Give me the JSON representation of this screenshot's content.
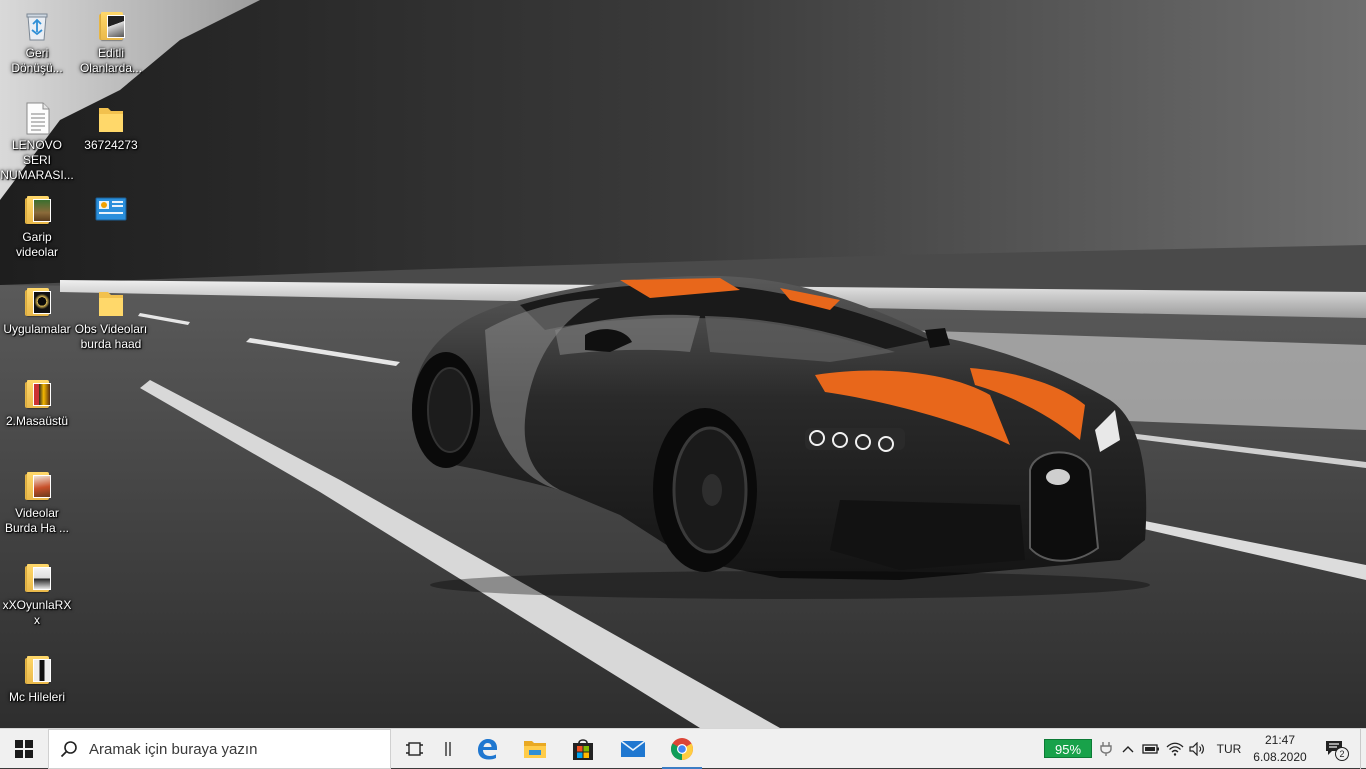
{
  "desktop": {
    "icons": [
      {
        "label": "Geri Dönüşü...",
        "icon": "recycle-bin-icon"
      },
      {
        "label": "Editli Olanlarda...",
        "icon": "folder-icon"
      },
      {
        "label": "LENOVO SERI NUMARASI...",
        "icon": "text-document-icon"
      },
      {
        "label": "36724273",
        "icon": "folder-icon"
      },
      {
        "label": "Garip videolar",
        "icon": "folder-icon"
      },
      {
        "label": "",
        "icon": "control-panel-shortcut-icon"
      },
      {
        "label": "Uygulamalar",
        "icon": "folder-icon"
      },
      {
        "label": "Obs Videoları burda haad",
        "icon": "folder-icon"
      },
      {
        "label": "2.Masaüstü",
        "icon": "folder-icon"
      },
      {
        "label": "Videolar Burda Ha ...",
        "icon": "folder-icon"
      },
      {
        "label": "xXOyunlaRXx",
        "icon": "folder-icon"
      },
      {
        "label": "Mc Hileleri",
        "icon": "folder-icon"
      }
    ]
  },
  "taskbar": {
    "search_placeholder": "Aramak için buraya yazın",
    "apps": [
      {
        "name": "task-view",
        "icon": "task-view-icon"
      },
      {
        "name": "separator",
        "icon": "separator-icon"
      },
      {
        "name": "edge",
        "icon": "edge-icon"
      },
      {
        "name": "file-explorer",
        "icon": "file-explorer-icon"
      },
      {
        "name": "microsoft-store",
        "icon": "store-icon"
      },
      {
        "name": "mail",
        "icon": "mail-icon"
      },
      {
        "name": "chrome",
        "icon": "chrome-icon",
        "active": true
      }
    ],
    "tray": {
      "battery_percent": "95%",
      "language": "TUR",
      "time": "21:47",
      "date": "6.08.2020",
      "notification_count": "2"
    }
  },
  "colors": {
    "taskbar_bg": "#f0f0f0",
    "battery_badge": "#18a24a",
    "accent": "#3c7dc4",
    "car_stripe": "#e8671b"
  }
}
